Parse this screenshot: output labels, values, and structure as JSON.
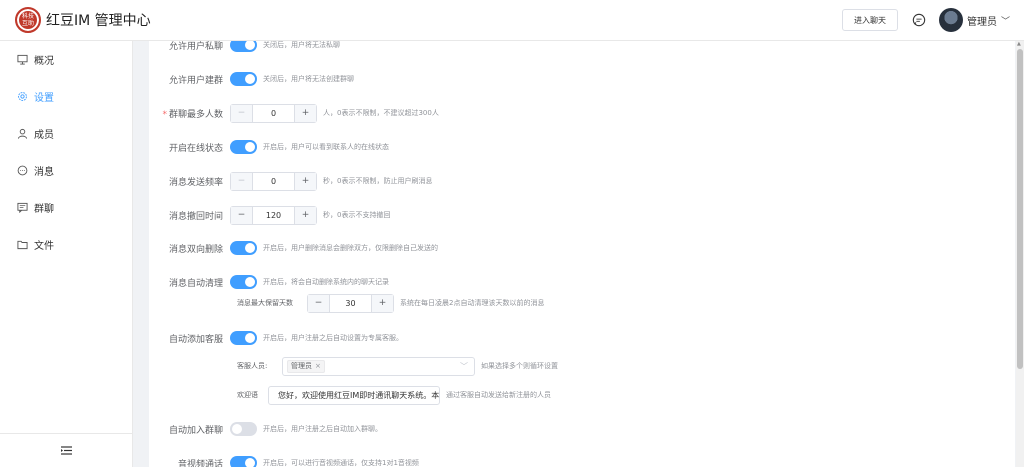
{
  "header": {
    "logo_text": [
      "科技",
      "互助"
    ],
    "title": "红豆IM 管理中心",
    "enter_chat_label": "进入聊天",
    "user_name": "管理员"
  },
  "sidebar": {
    "items": [
      {
        "label": "概况",
        "icon": "monitor-icon",
        "active": false
      },
      {
        "label": "设置",
        "icon": "gear-icon",
        "active": true
      },
      {
        "label": "成员",
        "icon": "user-icon",
        "active": false
      },
      {
        "label": "消息",
        "icon": "chat-bubble-icon",
        "active": false
      },
      {
        "label": "群聊",
        "icon": "group-chat-icon",
        "active": false
      },
      {
        "label": "文件",
        "icon": "folder-icon",
        "active": false
      }
    ],
    "collapse_icon": "menu-fold-icon"
  },
  "settings": {
    "private_chat": {
      "label": "允许用户私聊",
      "on": true,
      "desc": "关闭后，用户将无法私聊"
    },
    "create_group": {
      "label": "允许用户建群",
      "on": true,
      "desc": "关闭后，用户将无法创建群聊"
    },
    "max_group_members": {
      "label": "群聊最多人数",
      "required": true,
      "value": "0",
      "desc": "人，0表示不限制，不建议超过300人"
    },
    "online_status": {
      "label": "开启在线状态",
      "on": true,
      "desc": "开启后，用户可以看到联系人的在线状态"
    },
    "send_frequency": {
      "label": "消息发送频率",
      "value": "0",
      "desc": "秒，0表示不限制，防止用户刷消息"
    },
    "recall_time": {
      "label": "消息撤回时间",
      "value": "120",
      "desc": "秒，0表示不支持撤回"
    },
    "two_way_delete": {
      "label": "消息双向删除",
      "on": true,
      "desc": "开启后，用户删除消息会删除双方，仅限删除自己发送的"
    },
    "auto_clean": {
      "label": "消息自动清理",
      "on": true,
      "desc": "开启后，将会自动删除系统内的聊天记录",
      "retain_label": "消息最大保留天数",
      "retain_value": "30",
      "retain_desc": "系统在每日凌晨2点自动清理该天数以前的消息"
    },
    "auto_add_service": {
      "label": "自动添加客服",
      "on": true,
      "desc": "开启后，用户注册之后自动设置为专属客服。",
      "staff_label": "客服人员:",
      "staff_tag": "管理员",
      "staff_desc": "如果选择多个则循环设置",
      "welcome_label": "欢迎语",
      "welcome_value": "您好，欢迎使用红豆IM即时通讯聊天系统。本系",
      "welcome_desc": "通过客服自动发送给新注册的人员"
    },
    "auto_join_group": {
      "label": "自动加入群聊",
      "on": false,
      "desc": "开启后，用户注册之后自动加入群聊。"
    },
    "av_call": {
      "label": "音视频通话",
      "on": true,
      "desc": "开启后，可以进行音视频通话，仅支持1对1音视频"
    }
  },
  "colors": {
    "accent": "#409eff",
    "brand": "#c0392b"
  }
}
